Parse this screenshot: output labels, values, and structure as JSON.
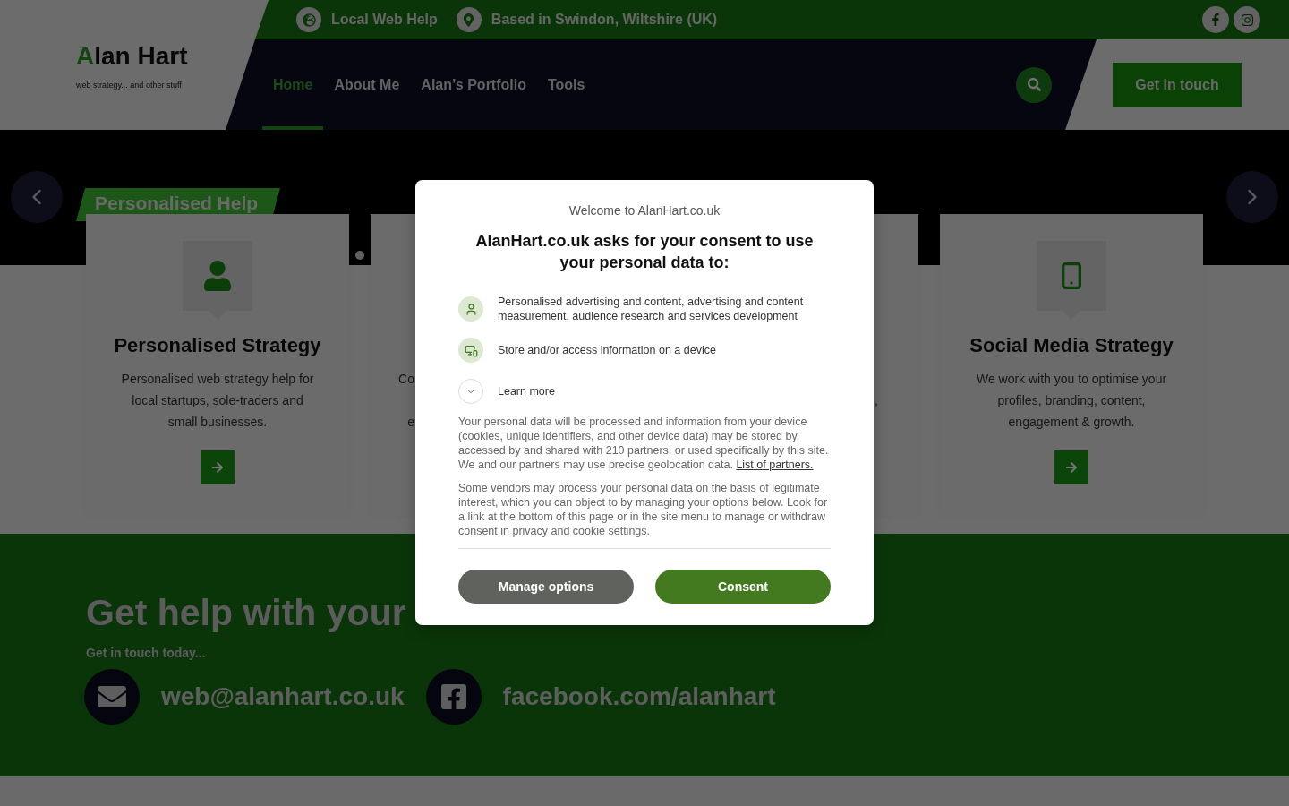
{
  "header": {
    "logo": {
      "accent": "A",
      "text": "lan Hart"
    },
    "tagline": "web strategy... and other stuff"
  },
  "top_bar": {
    "items": [
      "Local Web Help",
      "Based in Swindon, Wiltshire (UK)"
    ]
  },
  "nav": {
    "items": [
      {
        "label": "Home",
        "selected": true
      },
      {
        "label": "About Me",
        "selected": false
      },
      {
        "label": "Alan’s Portfolio",
        "selected": false
      },
      {
        "label": "Tools",
        "selected": false
      }
    ],
    "cta": "Get in touch"
  },
  "slider": {
    "tag": "Personalised Help",
    "cards": [
      {
        "kind": "full",
        "title": "Personalised Strategy",
        "description": "Personalised web strategy help for local startups, sole-traders and small businesses."
      },
      {
        "kind": "partial",
        "fragments": [
          "Co",
          "e"
        ]
      },
      {
        "kind": "partial",
        "fragments": [
          ","
        ]
      },
      {
        "kind": "full",
        "title": "Social Media Strategy",
        "description": "We work with you to optimise your profiles, branding, content, engagement & growth."
      }
    ]
  },
  "contact": {
    "heading": "Get help with your",
    "subheading": "Get in touch today...",
    "links": [
      "web@alanhart.co.uk",
      "facebook.com/alanhart"
    ]
  },
  "consent": {
    "welcome": "Welcome to AlanHart.co.uk",
    "heading": "AlanHart.co.uk asks for your consent to use your personal data to:",
    "purposes": [
      "Personalised advertising and content, advertising and content measurement, audience research and services development",
      "Store and/or access information on a device"
    ],
    "learn_more": {
      "label": "Learn more",
      "expanded": false
    },
    "paragraphs": [
      {
        "text": "Your personal data will be processed and information from your device (cookies, unique identifiers, and other device data) may be stored by, accessed by and shared with 210 partners, or used specifically by this site. We and our partners may use precise geolocation data.",
        "link": "List of partners."
      },
      {
        "text": "Some vendors may process your personal data on the basis of legitimate interest, which you can object to by managing your options below. Look for a link at the bottom of this page or in the site menu to manage or withdraw consent in privacy and cookie settings."
      }
    ],
    "buttons": [
      {
        "label": "Manage options",
        "kind": "secondary"
      },
      {
        "label": "Consent",
        "kind": "primary"
      }
    ]
  }
}
